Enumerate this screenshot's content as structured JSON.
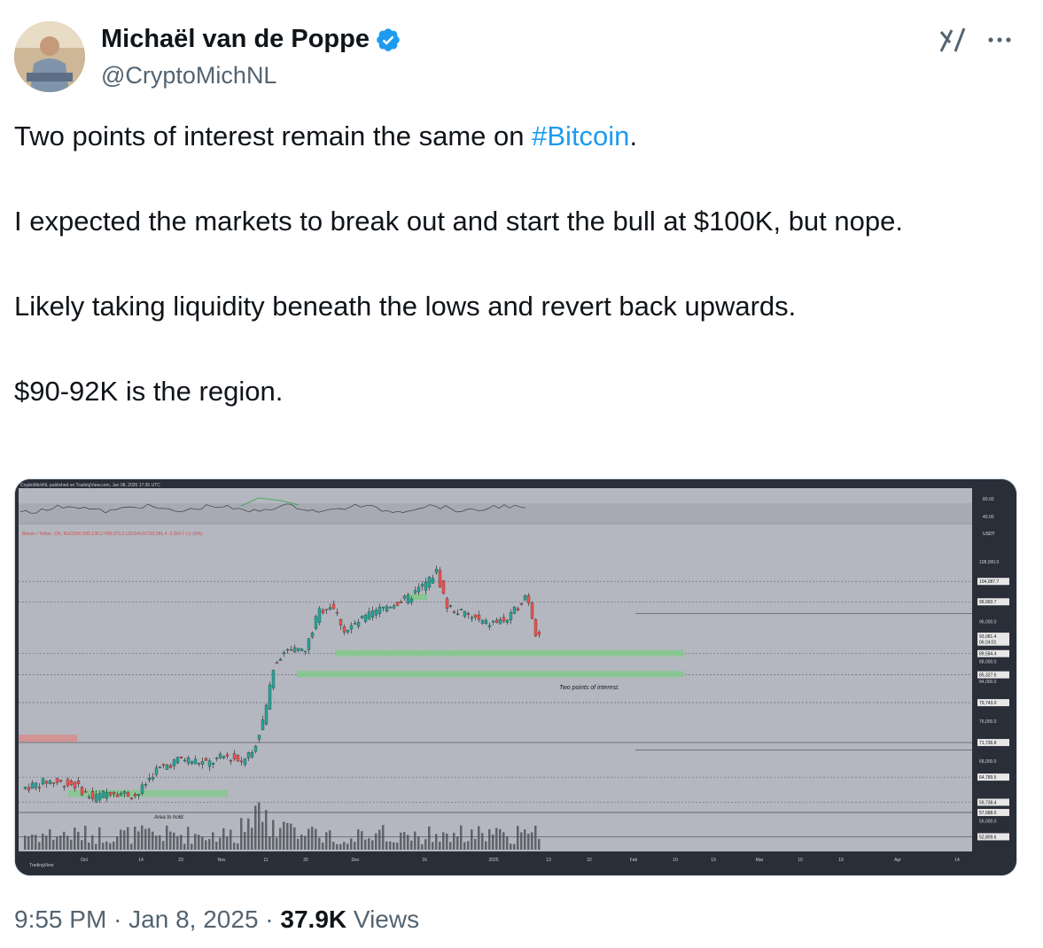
{
  "author": {
    "display_name": "Michaël van de Poppe",
    "handle": "@CryptoMichNL",
    "verified": true
  },
  "tweet": {
    "line1_prefix": "Two points of interest remain the same on ",
    "hashtag": "#Bitcoin",
    "line1_suffix": ".",
    "para2": "I expected the markets to break out and start the bull at $100K, but nope.",
    "para3": "Likely taking liquidity beneath the lows and revert back upwards.",
    "para4": "$90-92K is the region."
  },
  "meta": {
    "time": "9:55 PM",
    "date": "Jan 8, 2025",
    "views_count": "37.9K",
    "views_label": "Views",
    "separator": "·"
  },
  "icons": {
    "grok": "grok-icon",
    "more": "more-options-icon",
    "verified": "verified-badge-icon"
  },
  "chart": {
    "header": "CryptoMichNL published on TradingView.com, Jan 08, 2025 17:35 UTC",
    "symbol": "Bitcoin / Tether, 12h, KUCOIN  O95,136.2 H96,073.2 L92,540.8 C93,081.4 -2,054.7 (-2.16%)",
    "annotation_poi": "Two points of interest.",
    "annotation_hold": "Area to hold.",
    "footer": "TradingView",
    "currency": "USDT",
    "osc_labels": [
      "80.00",
      "40.00"
    ],
    "price_labels": [
      "108,000.0",
      "104,087.7",
      "99,993.7",
      "96,000.0",
      "93,081.4",
      "06:24:01",
      "89,584.4",
      "88,000.0",
      "85,327.6",
      "84,000.0",
      "79,743.0",
      "76,000.0",
      "71,736.8",
      "68,000.0",
      "64,789.5",
      "59,738.4",
      "57,688.0",
      "56,000.0",
      "52,809.6"
    ],
    "x_labels": [
      "Oct",
      "14",
      "23",
      "Nov",
      "11",
      "20",
      "Dec",
      "16",
      "2025",
      "13",
      "22",
      "Feb",
      "10",
      "19",
      "Mar",
      "10",
      "19",
      "Apr",
      "14"
    ]
  },
  "colors": {
    "accent": "#1d9bf0",
    "text": "#0f1419",
    "muted": "#536471",
    "chart_bg": "#b2b5be",
    "candle_up": "#26a69a",
    "candle_down": "#ef5350",
    "zone": "#7fc98a"
  }
}
